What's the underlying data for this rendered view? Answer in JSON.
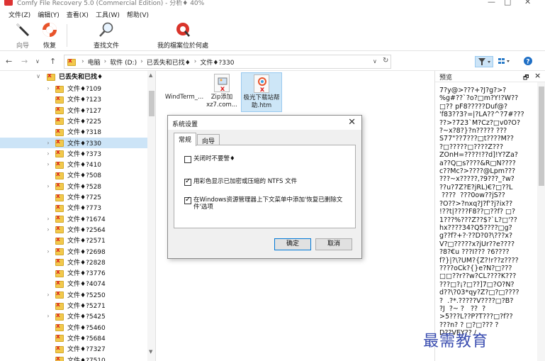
{
  "window": {
    "title": "Comfy File Recovery 5.0 (Commercial Edition) - 分析♦ 40%",
    "controls": [
      "—",
      "□",
      "✕"
    ]
  },
  "menu": [
    "文件(Z)",
    "编辑(Y)",
    "查看(X)",
    "工具(W)",
    "帮助(V)"
  ],
  "toolbar": {
    "wizard": "向导",
    "recover": "恢复",
    "find": "查找文件",
    "where": "我的檔案位於何處"
  },
  "address": {
    "crumbs": [
      "电脑",
      "软件 (D:)",
      "已丢失和已找♦",
      "文件♦?330"
    ],
    "back": "←",
    "forward": "→",
    "recent": "∨",
    "up": "↑",
    "dropdown": "∨",
    "refresh": "↻"
  },
  "tree": {
    "root": "已丢失和已找♦",
    "items": [
      {
        "label": "文件♦?109",
        "exp": true
      },
      {
        "label": "文件♦?123",
        "exp": false
      },
      {
        "label": "文件♦?127",
        "exp": false
      },
      {
        "label": "文件♦?225",
        "exp": false
      },
      {
        "label": "文件♦?318",
        "exp": false
      },
      {
        "label": "文件♦?330",
        "exp": true,
        "selected": true
      },
      {
        "label": "文件♦?373",
        "exp": true
      },
      {
        "label": "文件♦?410",
        "exp": true
      },
      {
        "label": "文件♦?508",
        "exp": false
      },
      {
        "label": "文件♦?528",
        "exp": true
      },
      {
        "label": "文件♦?725",
        "exp": false
      },
      {
        "label": "文件♦?773",
        "exp": false
      },
      {
        "label": "文件♦?1674",
        "exp": true
      },
      {
        "label": "文件♦?2564",
        "exp": true
      },
      {
        "label": "文件♦?2571",
        "exp": false
      },
      {
        "label": "文件♦?2698",
        "exp": true
      },
      {
        "label": "文件♦?2828",
        "exp": false
      },
      {
        "label": "文件♦?3776",
        "exp": false
      },
      {
        "label": "文件♦?4074",
        "exp": false
      },
      {
        "label": "文件♦?5250",
        "exp": true
      },
      {
        "label": "文件♦?5271",
        "exp": false
      },
      {
        "label": "文件♦?5425",
        "exp": true
      },
      {
        "label": "文件♦?5460",
        "exp": false
      },
      {
        "label": "文件♦?5684",
        "exp": false
      },
      {
        "label": "文件♦?7327",
        "exp": false
      },
      {
        "label": "文件♦?7510",
        "exp": false
      }
    ]
  },
  "files": [
    {
      "name": "WindTerm_...",
      "selected": false
    },
    {
      "name": "Zip添加xz7.com...",
      "selected": false
    },
    {
      "name": "极光下载站帮助.htm",
      "selected": true
    }
  ],
  "preview": {
    "title": "预览",
    "pin": "🗗",
    "close": "×",
    "text": "7?y@>???+?J?g?>?\n%g#??`?o?□m?Y!?W??\n□?? pF8?????Duf@?\n'f83??3?=|?LA??^?7#???\n??>?723`M?Cz?□v0?O?\n?~x?8?}?n????? ???\nS77\"??7???□t????M??\n?□?????□????Z???\nZOnH=????!??d]!Y?Za?\na??Q□s????&R□N????\nc??Mc?>????@Lpm???\n???~x?????,?9???_?w?\n??u?7Z?E?jRL)€?□??L\n ????  ???0ow??jS??\n?O??>?nxq?J?f'?j?ix??\n!??t|????F8??□??f? □?\n1???%???Z??$?`L?□'??\nhx????34?Q5????□g?\ng??f?+?·??D?0?\\???x?\nV?□?????x?jUr??e????\n?8?€u ???I??? ?6????\nf?}|?\\?UM?{Z?!r??z????\n????oCk?{}e?N?□???\n□□??r??w?CL????K???\n???□?¡?□??]7□?O?N?\nd??\\?03*qy?Z?□?□????\n?  .?*.?????V????□?B?\n?J  ?~ ?   ??  ?\n>5???L??P?T???□?f??\n???n? ? □?□??? ?\nD??VEY?? /"
  },
  "watermark": "最需教育",
  "dialog": {
    "title": "系统设置",
    "close": "✕",
    "tabs": [
      "常规",
      "向导"
    ],
    "options": [
      {
        "label": "关闭时不要警♦",
        "checked": false
      },
      {
        "label": "用彩色显示已加密或压缩的 NTFS 文件",
        "checked": true
      },
      {
        "label": "在Windows资源管理器上下文菜单中添加'恢复已删除文件'选项",
        "checked": true
      }
    ],
    "ok": "确定",
    "cancel": "取消"
  }
}
